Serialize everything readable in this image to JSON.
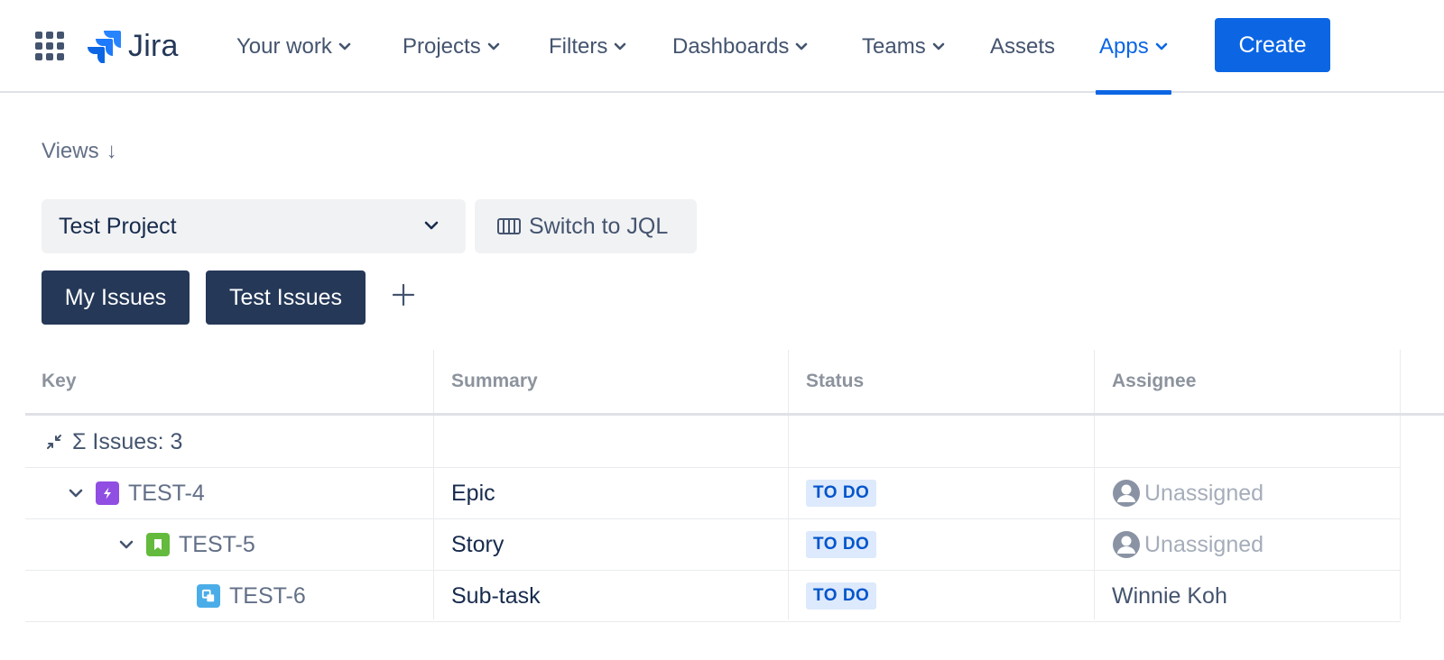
{
  "app": {
    "logo_text": "Jira"
  },
  "nav": {
    "items": [
      {
        "label": "Your work",
        "has_dropdown": true,
        "active": false
      },
      {
        "label": "Projects",
        "has_dropdown": true,
        "active": false
      },
      {
        "label": "Filters",
        "has_dropdown": true,
        "active": false
      },
      {
        "label": "Dashboards",
        "has_dropdown": true,
        "active": false
      },
      {
        "label": "Teams",
        "has_dropdown": true,
        "active": false
      },
      {
        "label": "Assets",
        "has_dropdown": false,
        "active": false
      },
      {
        "label": "Apps",
        "has_dropdown": true,
        "active": true
      }
    ],
    "create_label": "Create"
  },
  "views": {
    "label": "Views",
    "arrow": "↓",
    "project_select": "Test Project",
    "switch_jql_label": "Switch to JQL",
    "filters": [
      "My Issues",
      "Test Issues"
    ],
    "add_icon": "plus-icon"
  },
  "table": {
    "columns": [
      "Key",
      "Summary",
      "Status",
      "Assignee"
    ],
    "summary_row": "Σ Issues: 3",
    "rows": [
      {
        "key": "TEST-4",
        "type": "epic",
        "summary": "Epic",
        "status": "TO DO",
        "assignee": "Unassigned",
        "unassigned": true,
        "depth": 0,
        "expandable": true
      },
      {
        "key": "TEST-5",
        "type": "story",
        "summary": "Story",
        "status": "TO DO",
        "assignee": "Unassigned",
        "unassigned": true,
        "depth": 1,
        "expandable": true
      },
      {
        "key": "TEST-6",
        "type": "subtask",
        "summary": "Sub-task",
        "status": "TO DO",
        "assignee": "Winnie Koh",
        "unassigned": false,
        "depth": 2,
        "expandable": false
      }
    ]
  },
  "colors": {
    "brand_blue": "#0c66e4",
    "chip_navy": "#253858",
    "epic_purple": "#904ee2",
    "story_green": "#63ba3c",
    "subtask_blue": "#4bade8",
    "lozenge_bg": "#dde9fc",
    "lozenge_text": "#0055cc"
  }
}
